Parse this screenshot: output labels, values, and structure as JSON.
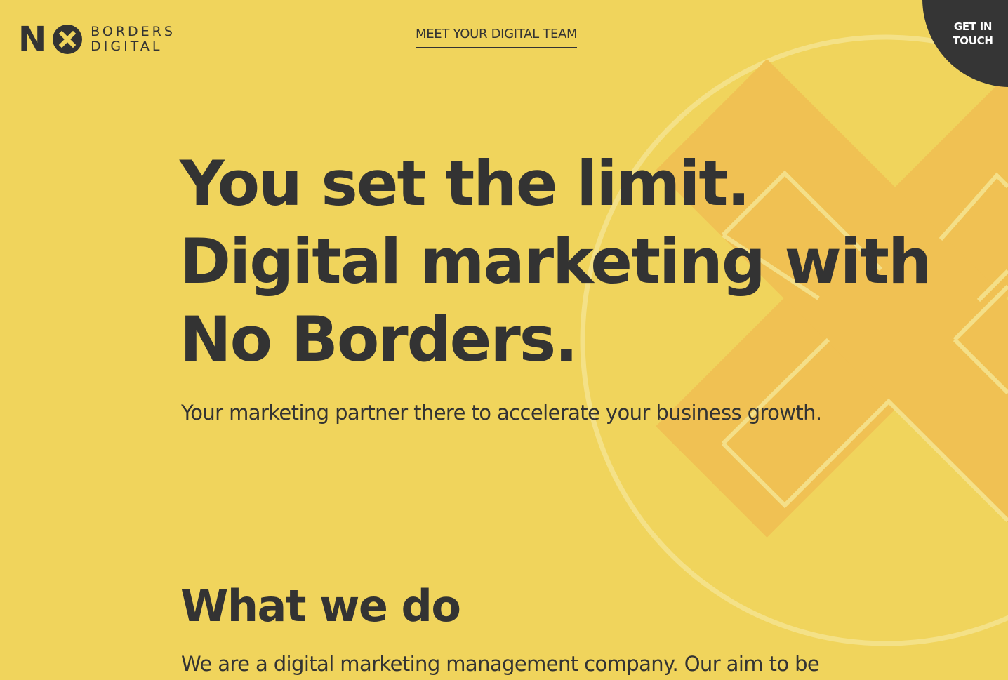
{
  "brand": {
    "logo_letter": "N",
    "logo_word_top": "BORDERS",
    "logo_word_bottom": "DIGITAL"
  },
  "nav": {
    "team_link": "MEET YOUR DIGITAL TEAM"
  },
  "cta": {
    "get_in_touch": "GET IN\nTOUCH"
  },
  "hero": {
    "title_lines": [
      "You set the limit.",
      "Digital marketing with",
      "No Borders."
    ],
    "subtitle": "Your marketing partner there to accelerate your business growth."
  },
  "what_we_do": {
    "heading": "What we do",
    "body": "We are a digital marketing management company. Our aim to be"
  },
  "colors": {
    "background": "#F0D45C",
    "text": "#333333",
    "cta_bg": "#353535",
    "cross_accent": "#F0C153",
    "outline": "#F5E38E"
  },
  "icons": {
    "logo_mark": "x-circle-icon",
    "background_art": "cross-in-circle-icon"
  }
}
